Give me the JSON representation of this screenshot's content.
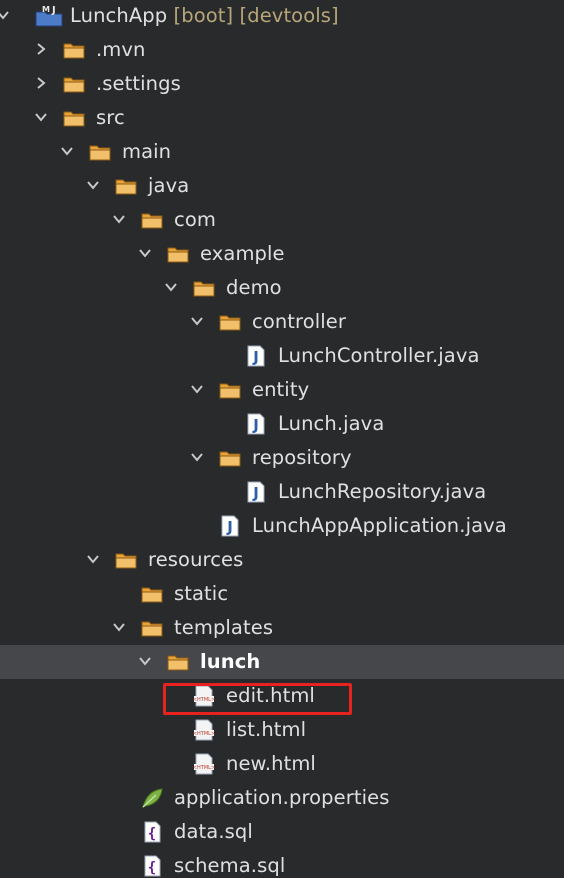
{
  "project": {
    "name": "LunchApp",
    "decorations": "[boot] [devtools]"
  },
  "tree": {
    "items": [
      {
        "label": "LunchApp",
        "decoration": "[boot] [devtools]",
        "depth": 0,
        "type": "project",
        "expanded": true,
        "name": "project-lunchapp"
      },
      {
        "label": ".mvn",
        "depth": 1,
        "type": "folder",
        "expanded": false,
        "name": "folder-mvn"
      },
      {
        "label": ".settings",
        "depth": 1,
        "type": "folder",
        "expanded": false,
        "name": "folder-settings"
      },
      {
        "label": "src",
        "depth": 1,
        "type": "folder",
        "expanded": true,
        "name": "folder-src"
      },
      {
        "label": "main",
        "depth": 2,
        "type": "folder",
        "expanded": true,
        "name": "folder-main"
      },
      {
        "label": "java",
        "depth": 3,
        "type": "folder",
        "expanded": true,
        "name": "folder-java"
      },
      {
        "label": "com",
        "depth": 4,
        "type": "folder",
        "expanded": true,
        "name": "folder-com"
      },
      {
        "label": "example",
        "depth": 5,
        "type": "folder",
        "expanded": true,
        "name": "folder-example"
      },
      {
        "label": "demo",
        "depth": 6,
        "type": "folder",
        "expanded": true,
        "name": "folder-demo"
      },
      {
        "label": "controller",
        "depth": 7,
        "type": "folder",
        "expanded": true,
        "name": "folder-controller"
      },
      {
        "label": "LunchController.java",
        "depth": 8,
        "type": "java",
        "name": "file-lunchcontroller-java"
      },
      {
        "label": "entity",
        "depth": 7,
        "type": "folder",
        "expanded": true,
        "name": "folder-entity"
      },
      {
        "label": "Lunch.java",
        "depth": 8,
        "type": "java",
        "name": "file-lunch-java"
      },
      {
        "label": "repository",
        "depth": 7,
        "type": "folder",
        "expanded": true,
        "name": "folder-repository"
      },
      {
        "label": "LunchRepository.java",
        "depth": 8,
        "type": "java",
        "name": "file-lunchrepository-java"
      },
      {
        "label": "LunchAppApplication.java",
        "depth": 7,
        "type": "java",
        "name": "file-lunchappapplication-java"
      },
      {
        "label": "resources",
        "depth": 3,
        "type": "folder",
        "expanded": true,
        "name": "folder-resources"
      },
      {
        "label": "static",
        "depth": 4,
        "type": "folder",
        "name": "folder-static"
      },
      {
        "label": "templates",
        "depth": 4,
        "type": "folder",
        "expanded": true,
        "name": "folder-templates"
      },
      {
        "label": "lunch",
        "depth": 5,
        "type": "folder",
        "expanded": true,
        "selected": true,
        "name": "folder-lunch"
      },
      {
        "label": "edit.html",
        "depth": 6,
        "type": "html",
        "highlighted": true,
        "name": "file-edit-html"
      },
      {
        "label": "list.html",
        "depth": 6,
        "type": "html",
        "name": "file-list-html"
      },
      {
        "label": "new.html",
        "depth": 6,
        "type": "html",
        "name": "file-new-html"
      },
      {
        "label": "application.properties",
        "depth": 4,
        "type": "properties",
        "name": "file-application-properties"
      },
      {
        "label": "data.sql",
        "depth": 4,
        "type": "sql",
        "name": "file-data-sql"
      },
      {
        "label": "schema.sql",
        "depth": 4,
        "type": "sql",
        "name": "file-schema-sql"
      }
    ]
  },
  "colors": {
    "background": "#292a2c",
    "selected_row": "#45474b",
    "text": "#e0e0e0",
    "decoration_text": "#b8a679",
    "folder": "#e8a33a",
    "java_icon": "#2b5fa8",
    "highlight_box": "#e8231f"
  },
  "icons": {
    "chevron_expanded": "chevron-down-icon",
    "chevron_collapsed": "chevron-right-icon",
    "folder": "folder-icon",
    "java": "java-file-icon",
    "html": "html-file-icon",
    "properties": "spring-leaf-icon",
    "sql": "sql-file-icon",
    "project": "maven-project-icon"
  }
}
